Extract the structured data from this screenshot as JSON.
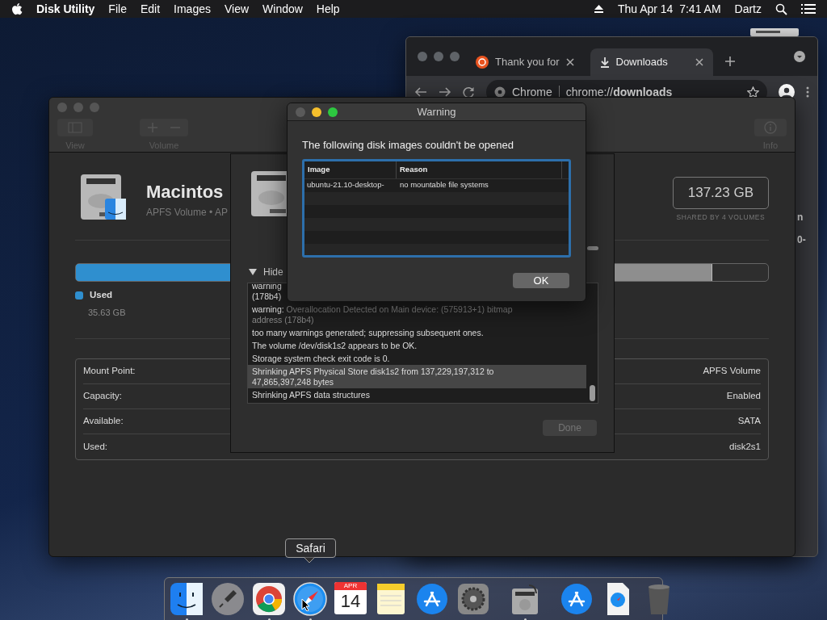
{
  "menu_bar": {
    "app_name": "Disk Utility",
    "items": [
      "File",
      "Edit",
      "Images",
      "View",
      "Window",
      "Help"
    ],
    "clock": "Thu Apr 14  7:41 AM",
    "user": "Dartz"
  },
  "browser_window": {
    "tabs": [
      {
        "label": "Thank you for",
        "selected": false,
        "kind": "ubuntu"
      },
      {
        "label": "Downloads",
        "selected": true,
        "kind": "download"
      }
    ],
    "address": {
      "site": "Chrome",
      "url": "chrome://**downloads**"
    },
    "content_fragments": [
      "n",
      "0-"
    ]
  },
  "disk_utility": {
    "toolbar": [
      {
        "label": "View",
        "kind": "view"
      },
      {
        "label": "Volume",
        "kind": "volume"
      },
      {
        "label": "Info",
        "kind": "info"
      }
    ],
    "volume": {
      "name": "Macintos",
      "subtitle": "APFS Volume • AP",
      "capacity": "137.23 GB",
      "capacity_note": "SHARED BY 4 VOLUMES"
    },
    "usage_bar": [
      {
        "kind": "used",
        "level": 0.24,
        "color": "#2f8fcf"
      },
      {
        "kind": "container_used",
        "level": 0.92,
        "color": "#8e8e8e"
      }
    ],
    "legend": {
      "label": "Used",
      "value": "35.63 GB",
      "color": "#2f8fcf"
    },
    "info_rows": [
      {
        "label": "Mount Point:",
        "value": "APFS Volume"
      },
      {
        "label": "Capacity:",
        "value": "Enabled"
      },
      {
        "label": "Available:",
        "value": "SATA"
      },
      {
        "label": "Used:",
        "value": "disk2s1"
      }
    ]
  },
  "first_aid_sheet": {
    "disclosure": {
      "label": "Hide",
      "expanded": true
    },
    "log": [
      {
        "lines": [
          "warning",
          "(178b4)"
        ],
        "selected": false
      },
      {
        "prefix": "warning:",
        "lines": [
          "Overallocation Detected on Main device: (575913+1) bitmap",
          "address (178b4)"
        ],
        "selected": false
      },
      {
        "lines": [
          "too many warnings generated; suppressing subsequent ones."
        ],
        "selected": false
      },
      {
        "lines": [
          "The volume /dev/disk1s2 appears to be OK."
        ],
        "selected": false
      },
      {
        "lines": [
          "Storage system check exit code is 0."
        ],
        "selected": false
      },
      {
        "lines": [
          "Shrinking APFS Physical Store disk1s2 from 137,229,197,312 to",
          "47,865,397,248 bytes"
        ],
        "selected": true
      },
      {
        "lines": [
          "Shrinking APFS data structures"
        ],
        "selected": false
      }
    ],
    "done_button": {
      "label": "Done",
      "disabled": true
    }
  },
  "warning_dialog": {
    "title": "Warning",
    "message": "The following disk images couldn't be opened",
    "columns": [
      "Image",
      "Reason"
    ],
    "rows": [
      [
        "ubuntu-21.10-desktop-",
        "no mountable file systems"
      ]
    ],
    "ok_button": "OK"
  },
  "dock": {
    "tooltip": "Safari",
    "items": [
      {
        "kind": "finder",
        "running": true
      },
      {
        "kind": "launchpad",
        "running": false
      },
      {
        "kind": "chrome",
        "running": true
      },
      {
        "kind": "safari",
        "running": true
      },
      {
        "kind": "calendar",
        "month": "APR",
        "day": "14",
        "running": false
      },
      {
        "kind": "notes",
        "running": false
      },
      {
        "kind": "appstore",
        "running": false
      },
      {
        "kind": "settings",
        "running": false
      },
      {
        "kind": "separator"
      },
      {
        "kind": "disk-utility",
        "running": true
      },
      {
        "kind": "separator"
      },
      {
        "kind": "appstore",
        "running": false
      },
      {
        "kind": "document",
        "running": false
      },
      {
        "kind": "trash",
        "running": false
      }
    ]
  }
}
